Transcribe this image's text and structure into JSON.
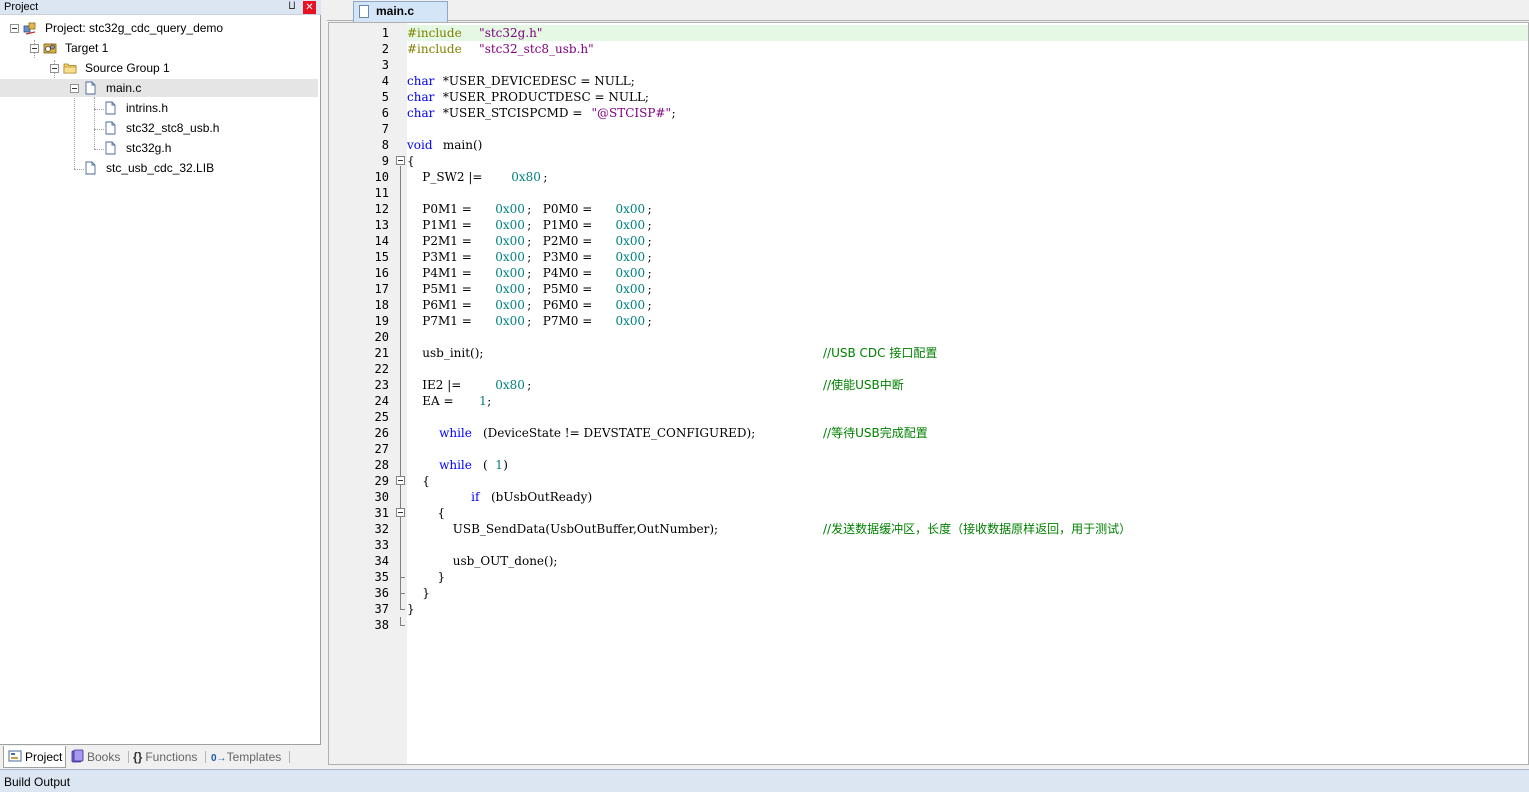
{
  "project_panel": {
    "title": "Project",
    "pin_glyph": "⨿",
    "close_glyph": "✕",
    "tree": [
      {
        "label": "Project: stc32g_cdc_query_demo",
        "icon": "project-icon"
      },
      {
        "label": "Target 1",
        "icon": "target-icon"
      },
      {
        "label": "Source Group 1",
        "icon": "folder-icon"
      },
      {
        "label": "main.c",
        "icon": "c-file-icon",
        "selected": true
      },
      {
        "label": "intrins.h",
        "icon": "header-file-icon"
      },
      {
        "label": "stc32_stc8_usb.h",
        "icon": "header-file-icon"
      },
      {
        "label": "stc32g.h",
        "icon": "header-file-icon"
      },
      {
        "label": "stc_usb_cdc_32.LIB",
        "icon": "lib-file-icon"
      }
    ],
    "tabs": [
      {
        "label": "Project",
        "active": true,
        "icon": "project-tab-icon"
      },
      {
        "label": "Books",
        "active": false,
        "icon": "books-icon"
      },
      {
        "label": "Functions",
        "active": false,
        "icon": "functions-icon",
        "glyph": "{}"
      },
      {
        "label": "Templates",
        "active": false,
        "icon": "templates-icon",
        "glyph": "0→"
      }
    ]
  },
  "editor": {
    "tab_label": "main.c",
    "current_line": 1,
    "lines": [
      {
        "n": "1",
        "tokens": [
          {
            "t": "#include ",
            "c": "pp"
          },
          {
            "t": "\"stc32g.h\"",
            "c": "str"
          }
        ]
      },
      {
        "n": "2",
        "tokens": [
          {
            "t": "#include ",
            "c": "pp"
          },
          {
            "t": "\"stc32_stc8_usb.h\"",
            "c": "str"
          }
        ]
      },
      {
        "n": "3",
        "tokens": []
      },
      {
        "n": "4",
        "tokens": [
          {
            "t": "char",
            "c": "kw"
          },
          {
            "t": " *USER_DEVICEDESC = NULL;",
            "c": "plain"
          }
        ]
      },
      {
        "n": "5",
        "tokens": [
          {
            "t": "char",
            "c": "kw"
          },
          {
            "t": " *USER_PRODUCTDESC = NULL;",
            "c": "plain"
          }
        ]
      },
      {
        "n": "6",
        "tokens": [
          {
            "t": "char",
            "c": "kw"
          },
          {
            "t": " *USER_STCISPCMD = ",
            "c": "plain"
          },
          {
            "t": "\"@STCISP#\"",
            "c": "str"
          },
          {
            "t": ";",
            "c": "plain"
          }
        ]
      },
      {
        "n": "7",
        "tokens": []
      },
      {
        "n": "8",
        "tokens": [
          {
            "t": "void",
            "c": "kw"
          },
          {
            "t": " main()",
            "c": "plain"
          }
        ]
      },
      {
        "n": "9",
        "tokens": [
          {
            "t": "{",
            "c": "plain"
          }
        ]
      },
      {
        "n": "10",
        "tokens": [
          {
            "t": "    P_SW2 |= ",
            "c": "plain"
          },
          {
            "t": "0x80",
            "c": "num"
          },
          {
            "t": ";",
            "c": "plain"
          }
        ]
      },
      {
        "n": "11",
        "tokens": []
      },
      {
        "n": "12",
        "tokens": [
          {
            "t": "    P0M1 = ",
            "c": "plain"
          },
          {
            "t": "0x00",
            "c": "num"
          },
          {
            "t": ";   P0M0 = ",
            "c": "plain"
          },
          {
            "t": "0x00",
            "c": "num"
          },
          {
            "t": ";",
            "c": "plain"
          }
        ]
      },
      {
        "n": "13",
        "tokens": [
          {
            "t": "    P1M1 = ",
            "c": "plain"
          },
          {
            "t": "0x00",
            "c": "num"
          },
          {
            "t": ";   P1M0 = ",
            "c": "plain"
          },
          {
            "t": "0x00",
            "c": "num"
          },
          {
            "t": ";",
            "c": "plain"
          }
        ]
      },
      {
        "n": "14",
        "tokens": [
          {
            "t": "    P2M1 = ",
            "c": "plain"
          },
          {
            "t": "0x00",
            "c": "num"
          },
          {
            "t": ";   P2M0 = ",
            "c": "plain"
          },
          {
            "t": "0x00",
            "c": "num"
          },
          {
            "t": ";",
            "c": "plain"
          }
        ]
      },
      {
        "n": "15",
        "tokens": [
          {
            "t": "    P3M1 = ",
            "c": "plain"
          },
          {
            "t": "0x00",
            "c": "num"
          },
          {
            "t": ";   P3M0 = ",
            "c": "plain"
          },
          {
            "t": "0x00",
            "c": "num"
          },
          {
            "t": ";",
            "c": "plain"
          }
        ]
      },
      {
        "n": "16",
        "tokens": [
          {
            "t": "    P4M1 = ",
            "c": "plain"
          },
          {
            "t": "0x00",
            "c": "num"
          },
          {
            "t": ";   P4M0 = ",
            "c": "plain"
          },
          {
            "t": "0x00",
            "c": "num"
          },
          {
            "t": ";",
            "c": "plain"
          }
        ]
      },
      {
        "n": "17",
        "tokens": [
          {
            "t": "    P5M1 = ",
            "c": "plain"
          },
          {
            "t": "0x00",
            "c": "num"
          },
          {
            "t": ";   P5M0 = ",
            "c": "plain"
          },
          {
            "t": "0x00",
            "c": "num"
          },
          {
            "t": ";",
            "c": "plain"
          }
        ]
      },
      {
        "n": "18",
        "tokens": [
          {
            "t": "    P6M1 = ",
            "c": "plain"
          },
          {
            "t": "0x00",
            "c": "num"
          },
          {
            "t": ";   P6M0 = ",
            "c": "plain"
          },
          {
            "t": "0x00",
            "c": "num"
          },
          {
            "t": ";",
            "c": "plain"
          }
        ]
      },
      {
        "n": "19",
        "tokens": [
          {
            "t": "    P7M1 = ",
            "c": "plain"
          },
          {
            "t": "0x00",
            "c": "num"
          },
          {
            "t": ";   P7M0 = ",
            "c": "plain"
          },
          {
            "t": "0x00",
            "c": "num"
          },
          {
            "t": ";",
            "c": "plain"
          }
        ]
      },
      {
        "n": "20",
        "tokens": []
      },
      {
        "n": "21",
        "tokens": [
          {
            "t": "    usb_init();",
            "c": "plain"
          }
        ],
        "comment": "//USB CDC 接口配置"
      },
      {
        "n": "22",
        "tokens": []
      },
      {
        "n": "23",
        "tokens": [
          {
            "t": "    IE2 |= ",
            "c": "plain"
          },
          {
            "t": "0x80",
            "c": "num"
          },
          {
            "t": ";",
            "c": "plain"
          }
        ],
        "comment": "//使能USB中断"
      },
      {
        "n": "24",
        "tokens": [
          {
            "t": "    EA = ",
            "c": "plain"
          },
          {
            "t": "1",
            "c": "num"
          },
          {
            "t": ";",
            "c": "plain"
          }
        ]
      },
      {
        "n": "25",
        "tokens": []
      },
      {
        "n": "26",
        "tokens": [
          {
            "t": "    ",
            "c": "plain"
          },
          {
            "t": "while",
            "c": "kw"
          },
          {
            "t": " (DeviceState != DEVSTATE_CONFIGURED);",
            "c": "plain"
          }
        ],
        "comment": "//等待USB完成配置"
      },
      {
        "n": "27",
        "tokens": []
      },
      {
        "n": "28",
        "tokens": [
          {
            "t": "    ",
            "c": "plain"
          },
          {
            "t": "while",
            "c": "kw"
          },
          {
            "t": " (",
            "c": "plain"
          },
          {
            "t": "1",
            "c": "num"
          },
          {
            "t": ")",
            "c": "plain"
          }
        ]
      },
      {
        "n": "29",
        "tokens": [
          {
            "t": "    {",
            "c": "plain"
          }
        ]
      },
      {
        "n": "30",
        "tokens": [
          {
            "t": "        ",
            "c": "plain"
          },
          {
            "t": "if",
            "c": "kw"
          },
          {
            "t": " (bUsbOutReady)",
            "c": "plain"
          }
        ]
      },
      {
        "n": "31",
        "tokens": [
          {
            "t": "        {",
            "c": "plain"
          }
        ]
      },
      {
        "n": "32",
        "tokens": [
          {
            "t": "            USB_SendData(UsbOutBuffer,OutNumber);",
            "c": "plain"
          }
        ],
        "comment": "//发送数据缓冲区，长度（接收数据原样返回，用于测试）"
      },
      {
        "n": "33",
        "tokens": []
      },
      {
        "n": "34",
        "tokens": [
          {
            "t": "            usb_OUT_done();",
            "c": "plain"
          }
        ]
      },
      {
        "n": "35",
        "tokens": [
          {
            "t": "        }",
            "c": "plain"
          }
        ]
      },
      {
        "n": "36",
        "tokens": [
          {
            "t": "    }",
            "c": "plain"
          }
        ]
      },
      {
        "n": "37",
        "tokens": [
          {
            "t": "}",
            "c": "plain"
          }
        ]
      },
      {
        "n": "38",
        "tokens": []
      }
    ]
  },
  "build_output": {
    "label": "Build Output"
  },
  "colors": {
    "keyword": "#0000ff",
    "preprocessor": "#808000",
    "string": "#800080",
    "number": "#008080",
    "comment": "#008000",
    "current_line": "#e4f8e4",
    "panel_title": "#dce6f2"
  }
}
